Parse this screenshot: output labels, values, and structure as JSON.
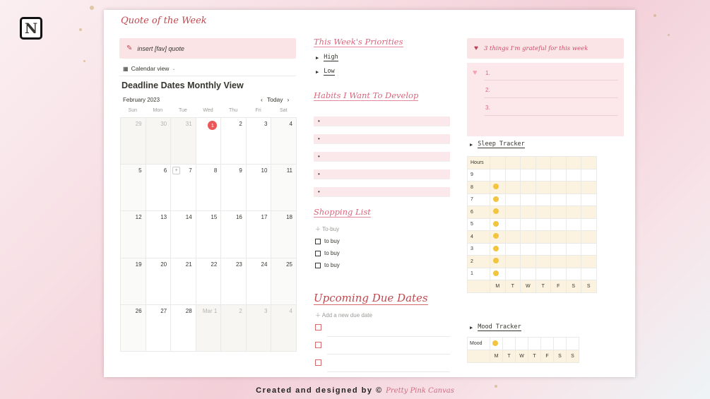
{
  "logo": {
    "letter": "N",
    "icon": "notion-logo"
  },
  "quote_section": {
    "title": "Quote of the Week",
    "placeholder": "insert [fav] quote",
    "icon": "pencil-icon"
  },
  "calendar": {
    "view_label": "Calendar view",
    "title": "Deadline Dates Monthly View",
    "month_label": "February 2023",
    "today_label": "Today",
    "weekdays": [
      "Sun",
      "Mon",
      "Tue",
      "Wed",
      "Thu",
      "Fri",
      "Sat"
    ],
    "weeks": [
      [
        {
          "d": "29",
          "off": true
        },
        {
          "d": "30",
          "off": true
        },
        {
          "d": "31",
          "off": true
        },
        {
          "d": "1",
          "today": true
        },
        {
          "d": "2"
        },
        {
          "d": "3"
        },
        {
          "d": "4"
        }
      ],
      [
        {
          "d": "5"
        },
        {
          "d": "6"
        },
        {
          "d": "7",
          "plus": true
        },
        {
          "d": "8"
        },
        {
          "d": "9"
        },
        {
          "d": "10"
        },
        {
          "d": "11"
        }
      ],
      [
        {
          "d": "12"
        },
        {
          "d": "13"
        },
        {
          "d": "14"
        },
        {
          "d": "15"
        },
        {
          "d": "16"
        },
        {
          "d": "17"
        },
        {
          "d": "18"
        }
      ],
      [
        {
          "d": "19"
        },
        {
          "d": "20"
        },
        {
          "d": "21"
        },
        {
          "d": "22"
        },
        {
          "d": "23"
        },
        {
          "d": "24"
        },
        {
          "d": "25"
        }
      ],
      [
        {
          "d": "26"
        },
        {
          "d": "27"
        },
        {
          "d": "28"
        },
        {
          "d": "Mar 1",
          "off": true
        },
        {
          "d": "2",
          "off": true
        },
        {
          "d": "3",
          "off": true
        },
        {
          "d": "4",
          "off": true
        }
      ]
    ]
  },
  "priorities": {
    "title": "This Week's Priorities",
    "items": [
      "High",
      "Low"
    ]
  },
  "habits": {
    "title": "Habits I Want To Develop",
    "bullet": "•",
    "count": 5
  },
  "shopping": {
    "title": "Shopping List",
    "add_label": "To-buy",
    "items": [
      "to buy",
      "to buy",
      "to buy"
    ]
  },
  "due_dates": {
    "title": "Upcoming Due Dates",
    "add_label": "Add a new due date",
    "count": 3
  },
  "grateful": {
    "title": "3 things I'm grateful for this week",
    "items": [
      "1.",
      "2.",
      "3."
    ]
  },
  "sleep": {
    "title": "Sleep Tracker",
    "header": "Hours",
    "rows": [
      "9",
      "8",
      "7",
      "6",
      "5",
      "4",
      "3",
      "2",
      "1"
    ],
    "days": [
      "M",
      "T",
      "W",
      "T",
      "F",
      "S",
      "S"
    ]
  },
  "mood": {
    "title": "Mood Tracker",
    "label": "Mood",
    "days": [
      "M",
      "T",
      "W",
      "T",
      "F",
      "S",
      "S"
    ]
  },
  "footer": {
    "text": "Created and designed by ©",
    "signature": "Pretty Pink Canvas"
  },
  "colors": {
    "accent": "#d9667d",
    "callout_bg": "#fbe4e6",
    "today": "#eb5757",
    "tracker_fill": "#fbf3df"
  }
}
